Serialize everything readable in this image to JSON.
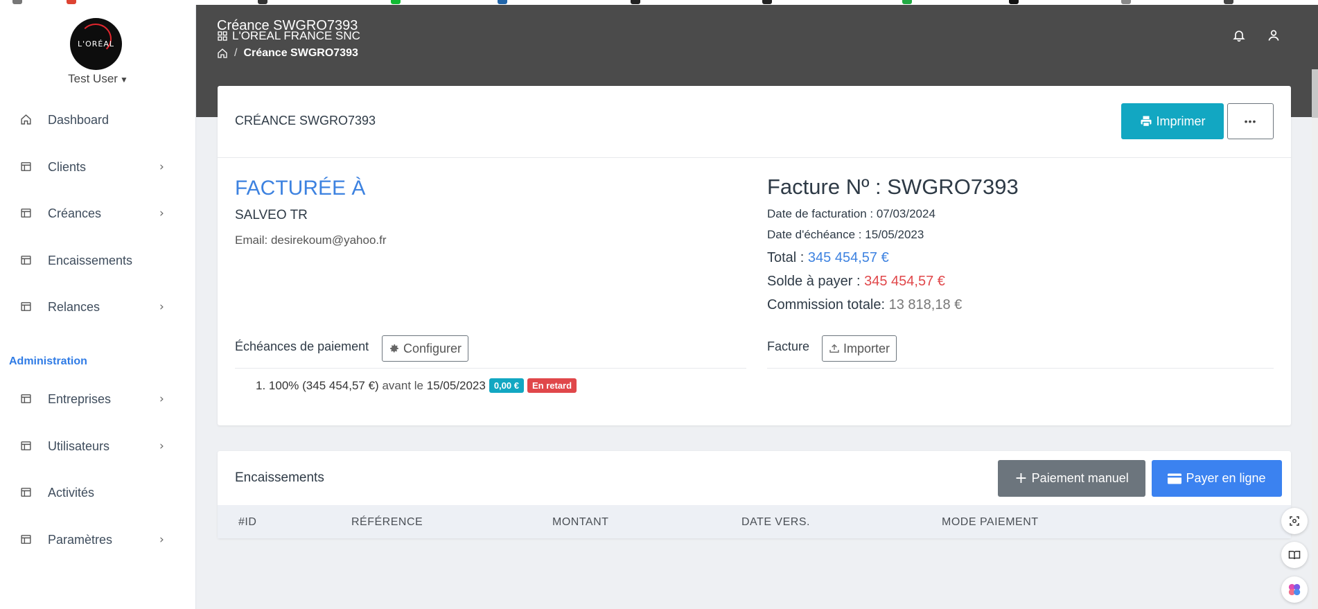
{
  "colors": {
    "topbar": "#4b4b4b",
    "accent_blue": "#3d82e0",
    "print_button": "#12a7c2",
    "danger": "#e0474a",
    "secondary": "#6c757d",
    "online_button": "#3b82f0",
    "page_bg": "#eef0f3"
  },
  "sidebar": {
    "logo_text": "L'ORÉAL",
    "user_name": "Test User",
    "user_caret_icon": "caret-down-icon",
    "items": [
      {
        "label": "Dashboard",
        "icon": "home-icon",
        "has_submenu": false
      },
      {
        "label": "Clients",
        "icon": "table-icon",
        "has_submenu": true
      },
      {
        "label": "Créances",
        "icon": "table-icon",
        "has_submenu": true
      },
      {
        "label": "Encaissements",
        "icon": "table-icon",
        "has_submenu": false
      },
      {
        "label": "Relances",
        "icon": "table-icon",
        "has_submenu": true
      }
    ],
    "admin_title": "Administration",
    "admin_items": [
      {
        "label": "Entreprises",
        "icon": "table-icon",
        "has_submenu": true
      },
      {
        "label": "Utilisateurs",
        "icon": "table-icon",
        "has_submenu": true
      },
      {
        "label": "Activités",
        "icon": "table-icon",
        "has_submenu": false
      },
      {
        "label": "Paramètres",
        "icon": "table-icon",
        "has_submenu": true
      }
    ]
  },
  "header": {
    "page_title": "Créance SWGRO7393",
    "company": "L'OREAL FRANCE SNC",
    "breadcrumb_current": "Créance SWGRO7393",
    "icons": [
      "bell-icon",
      "user-icon"
    ]
  },
  "invoice_card": {
    "title": "CRÉANCE SWGRO7393",
    "print_label": "Imprimer",
    "more_label": "•••",
    "billed_to_title": "FACTURÉE À",
    "client_name": "SALVEO TR",
    "email_label": "Email:",
    "email_value": "desirekoum@yahoo.fr",
    "invoice_title": "Facture Nº : SWGRO7393",
    "billing_date_label": "Date de facturation :",
    "billing_date": "07/03/2024",
    "due_date_label": "Date d'échéance :",
    "due_date": "15/05/2023",
    "total_label": "Total :",
    "total_value": "345 454,57 €",
    "balance_label": "Solde à payer :",
    "balance_value": "345 454,57 €",
    "commission_label": "Commission totale:",
    "commission_value": "13 818,18 €",
    "schedules_label": "Échéances de paiement",
    "configure_label": "Configurer",
    "invoice_file_label": "Facture",
    "import_label": "Importer",
    "schedule": {
      "index": "1.",
      "share": "100% (345 454,57 €)",
      "before": "avant le",
      "date": "15/05/2023",
      "paid_badge": "0,00 €",
      "status_badge": "En retard"
    }
  },
  "payments_card": {
    "title": "Encaissements",
    "manual_label": "Paiement manuel",
    "online_label": "Payer en ligne",
    "columns": [
      "#ID",
      "RÉFÉRENCE",
      "MONTANT",
      "DATE VERS.",
      "MODE PAIEMENT"
    ],
    "rows": []
  },
  "floating_buttons": [
    "screen-capture-icon",
    "book-icon",
    "brain-icon"
  ]
}
